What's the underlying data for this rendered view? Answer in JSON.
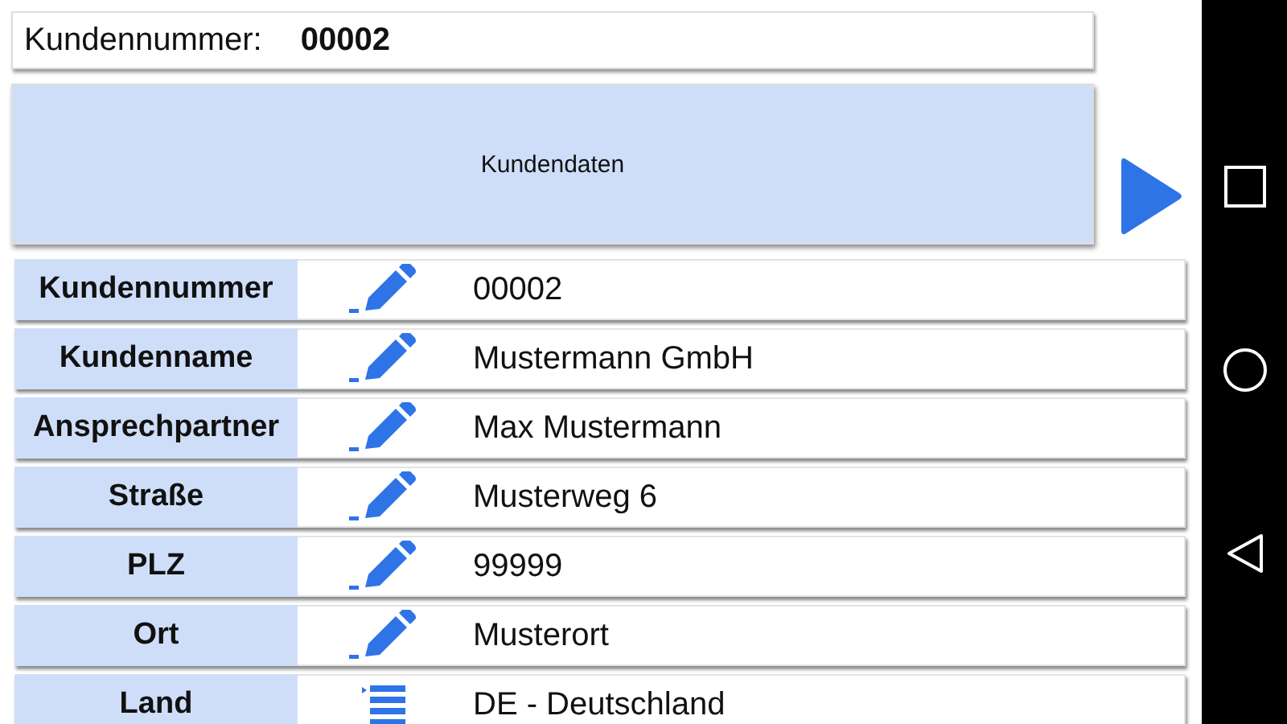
{
  "header": {
    "label": "Kundennummer:",
    "value": "00002"
  },
  "section_button": {
    "label": "Kundendaten"
  },
  "rows": [
    {
      "label": "Kundennummer",
      "kind": "edit",
      "value": "00002"
    },
    {
      "label": "Kundenname",
      "kind": "edit",
      "value": "Mustermann GmbH"
    },
    {
      "label": "Ansprechpartner",
      "kind": "edit",
      "value": "Max Mustermann"
    },
    {
      "label": "Straße",
      "kind": "edit",
      "value": "Musterweg 6"
    },
    {
      "label": "PLZ",
      "kind": "edit",
      "value": "99999"
    },
    {
      "label": "Ort",
      "kind": "edit",
      "value": "Musterort"
    },
    {
      "label": "Land",
      "kind": "select",
      "value": "DE - Deutschland"
    }
  ]
}
